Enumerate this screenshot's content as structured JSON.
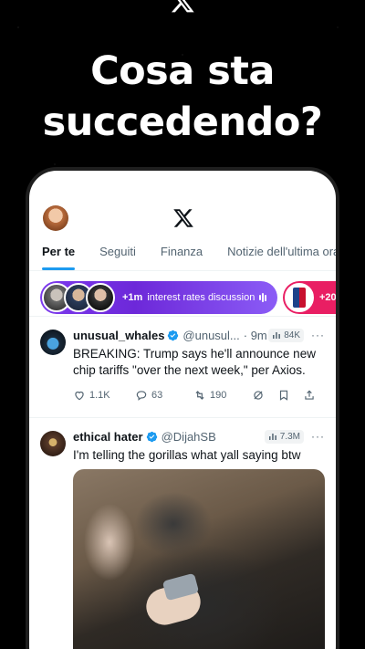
{
  "headline": "Cosa sta succedendo?",
  "feed": {
    "tabs": [
      {
        "label": "Per te",
        "active": true
      },
      {
        "label": "Seguiti",
        "active": false
      },
      {
        "label": "Finanza",
        "active": false
      },
      {
        "label": "Notizie dell'ultima ora",
        "active": false
      }
    ],
    "spaces": [
      {
        "count": "+1m",
        "title": "interest rates discussion"
      },
      {
        "count": "+20"
      }
    ],
    "tweets": [
      {
        "name": "unusual_whales",
        "handle": "@unusul...",
        "time": "· 9m",
        "views": "84K",
        "text": "BREAKING: Trump says he'll announce new chip tariffs \"over the next week,\" per Axios.",
        "likes": "1.1K",
        "replies": "63",
        "retweets": "190"
      },
      {
        "name": "ethical hater",
        "handle": "@DijahSB",
        "views": "7.3M",
        "text": "I'm telling the gorillas what yall saying btw"
      }
    ]
  },
  "colors": {
    "accent": "#1d9bf0",
    "space_purple": "#7c3aed",
    "space_pink": "#e91e63",
    "background": "#000000"
  },
  "icons": [
    "x-logo-icon",
    "verified-badge-icon",
    "views-chart-icon",
    "more-icon",
    "like-icon",
    "reply-icon",
    "retweet-icon",
    "grok-icon",
    "bookmark-icon",
    "share-icon",
    "audio-wave-icon"
  ]
}
